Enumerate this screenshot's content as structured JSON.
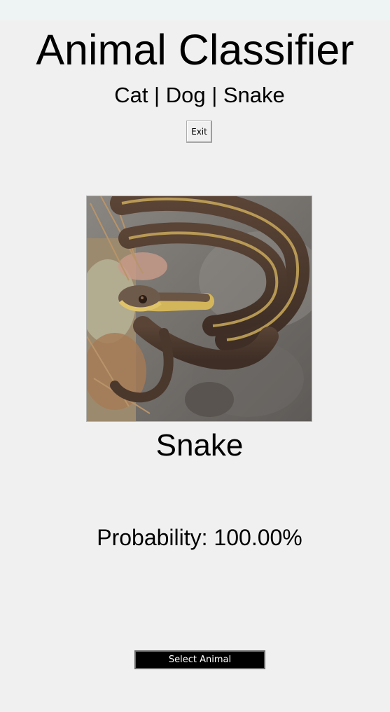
{
  "app": {
    "title": "Animal Classifier",
    "subtitle": "Cat | Dog | Snake"
  },
  "toolbar": {
    "exit_label": "Exit"
  },
  "result": {
    "image_icon": "snake-photo",
    "label": "Snake",
    "probability_text": "Probability: 100.00%"
  },
  "actions": {
    "select_label": "Select Animal"
  },
  "colors": {
    "window_background": "#f0f0f0",
    "titlebar": "#eef3f3",
    "select_button_bg": "#000000",
    "select_button_text": "#ffffff"
  }
}
